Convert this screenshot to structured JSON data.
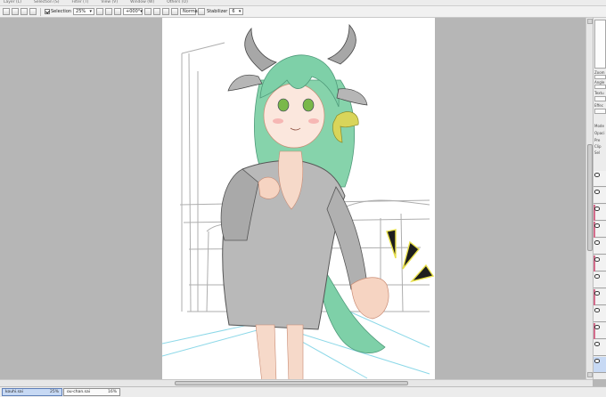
{
  "menu": {
    "items": [
      "Layer (L)",
      "Selection (S)",
      "Filter (T)",
      "View (V)",
      "Window (W)",
      "Others (O)"
    ]
  },
  "toolbar": {
    "selection_label": "Selection",
    "zoom_value": "25%",
    "rotation_value": "+000°",
    "blend_mode": "Normal",
    "stabilizer_label": "Stabilizer",
    "stabilizer_value": "6"
  },
  "right_panel": {
    "zoom_label": "Zoom",
    "angle_label": "Angle",
    "texture_label": "Textu",
    "effect_label": "Effec",
    "mode_label": "Mode",
    "opacity_label": "Opaci",
    "preserve_label": "Pre",
    "clip_label": "Clip",
    "select_label": "Sel"
  },
  "tabs": [
    {
      "name": "kouhi.sai",
      "zoom": "25%",
      "active": true
    },
    {
      "name": "ou-chan.sai",
      "zoom": "16%",
      "active": false
    }
  ],
  "colors": {
    "hair": "#7ed0a8",
    "robe": "#b9b9b9",
    "ribbon": "#d9d55a",
    "horn": "#a7a7a7",
    "accent_tab": "#c7d9f4"
  }
}
